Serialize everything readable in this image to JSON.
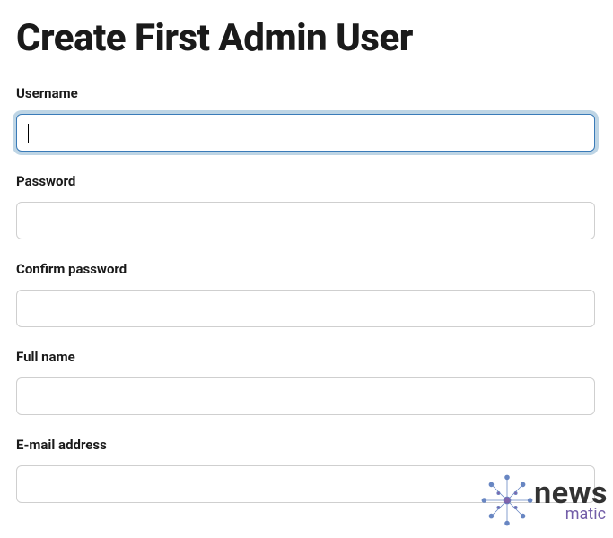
{
  "page": {
    "title": "Create First Admin User"
  },
  "form": {
    "username": {
      "label": "Username",
      "value": ""
    },
    "password": {
      "label": "Password",
      "value": ""
    },
    "confirm_password": {
      "label": "Confirm password",
      "value": ""
    },
    "full_name": {
      "label": "Full name",
      "value": ""
    },
    "email": {
      "label": "E-mail address",
      "value": ""
    }
  },
  "watermark": {
    "brand_top": "news",
    "brand_bottom": "matic"
  }
}
